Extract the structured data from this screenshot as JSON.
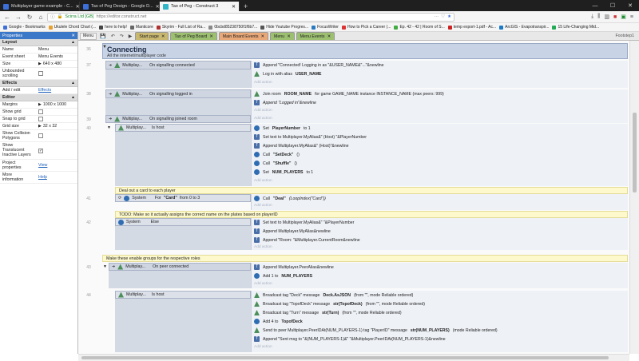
{
  "browser": {
    "tabs": [
      {
        "title": "Multiplayer game example - C...",
        "color": "#3d6fd8"
      },
      {
        "title": "Tao of Peg Design - Google D...",
        "color": "#3d6fd8"
      },
      {
        "title": "Tao of Peg - Construct 3",
        "color": "#2fb6c9"
      }
    ],
    "url_secure_label": "Scirra Ltd [GB]",
    "url": "https://editor.construct.net",
    "bookmarks": [
      "Google - Bookmarks",
      "Ukulele Chord Chart (...",
      "here to help!",
      "Manticore",
      "Skyrim - Full List of Ra...",
      "0bcbd85238750f1f6b7...",
      "Hide Youtube Progres...",
      "FocusWriter",
      "How to Pick a Career (...",
      "Ep. 42 - 42 | Room of S...",
      "temp export-1.pdf - Ac...",
      "ArcGIS - Evapotranspir...",
      "15 Life-Changing Mid..."
    ]
  },
  "properties": {
    "title": "Properties",
    "sections": {
      "layout": "Layout",
      "effects": "Effects",
      "editor": "Editor",
      "more_label_1": "Project properties",
      "more_value_1": "View",
      "more_label_2": "More information",
      "more_value_2": "Help"
    },
    "layout_rows": [
      {
        "k": "Name",
        "v": "Menu"
      },
      {
        "k": "Event sheet",
        "v": "Menu Events"
      },
      {
        "k": "Size",
        "v": "640 x 480"
      },
      {
        "k": "Unbounded scrolling",
        "v": ""
      }
    ],
    "effects_row": {
      "k": "Add / edit",
      "v": "Effects"
    },
    "editor_rows": [
      {
        "k": "Margins",
        "v": "1000 x 1000"
      },
      {
        "k": "Show grid",
        "v": ""
      },
      {
        "k": "Snap to grid",
        "v": ""
      },
      {
        "k": "Grid size",
        "v": "32 x 32"
      },
      {
        "k": "Show Collision Polygons",
        "v": ""
      },
      {
        "k": "Show Translucent Inactive Layers",
        "v": "✓"
      }
    ]
  },
  "editor": {
    "menu_label": "Menu",
    "tabs": [
      {
        "label": "Start page",
        "color": "#c8b870"
      },
      {
        "label": "Tao of Peg Board",
        "color": "#9cc070"
      },
      {
        "label": "Main Board Events",
        "color": "#e8a878"
      },
      {
        "label": "Menu",
        "color": "#9cc070"
      },
      {
        "label": "Menu Events",
        "color": "#9cc070"
      }
    ],
    "footer_tab": "Footstep1"
  },
  "events": {
    "group_title": "Connecting",
    "group_desc": "All the internet/multiplayer code",
    "line_numbers": [
      "36",
      "37",
      "38",
      "39",
      "40",
      "41",
      "42",
      "43",
      "44",
      "45"
    ],
    "e37_object": "Multiplay...",
    "e37_cond": "On signalling connected",
    "e37_a1": "Append \"Connected! Logging in as \"&USER_NAME&\"...\"&newline",
    "e37_a2_pre": "Log in with alias",
    "e37_a2_b": "USER_NAME",
    "e38_object": "Multiplay...",
    "e38_cond": "On signalling logged in",
    "e38_a1_pre": "Join room",
    "e38_a1_b1": "ROOM_NAME",
    "e38_a1_mid": "for game GAME_NAME instance INSTANCE_NAME (max peers: 999)",
    "e38_a2": "Append \"Logged in\"&newline",
    "e39_object": "Multiplay...",
    "e39_cond": "On signalling joined room",
    "e40_object": "Multiplay...",
    "e40_cond": "Is host",
    "e40_a1_pre": "Set",
    "e40_a1_b": "PlayerNumber",
    "e40_a1_post": "to 1",
    "e40_a2": "Set text to Multiplayer.MyAlias&\" (Host) \"&PlayerNumber",
    "e40_a3": "Append Multiplayer.MyAlias&\" (Host)\"&newline",
    "e40_a4_pre": "Call",
    "e40_a4_b": "\"SetDeck\"",
    "e40_a4_post": "()",
    "e40_a5_pre": "Call",
    "e40_a5_b": "\"Shuffle\"",
    "e40_a5_post": "()",
    "e40_a6_pre": "Set",
    "e40_a6_b": "NUM_PLAYERS",
    "e40_a6_post": "to 1",
    "comment1": "Deal out a card to each player",
    "e41_object": "System",
    "e41_cond_pre": "For",
    "e41_cond_b": "\"Card\"",
    "e41_cond_post": "from 0 to 3",
    "e41_a1_pre": "Call",
    "e41_a1_b": "\"Deal\"",
    "e41_a1_post": "(LoopIndex(\"Card\"))",
    "comment2": "TODO: Make so it actually assigns the correct name on the plates based on playerID",
    "e42_object": "System",
    "e42_cond": "Else",
    "e42_a1": "Set text to Multiplayer.MyAlias&\" \"&PlayerNumber",
    "e42_a2": "Append Multiplayer.MyAlias&newline",
    "e42_a3": "Append \"Room: \"&Multiplayer.CurrentRoom&newline",
    "comment3": "Make these enable groups for the respective roles",
    "e43_object": "Multiplay...",
    "e43_cond": "On peer connected",
    "e43_a1": "Append Multiplayer.PeerAlias&newline",
    "e43_a2_pre": "Add 1 to",
    "e43_a2_b": "NUM_PLAYERS",
    "e44_object": "Multiplay...",
    "e44_cond": "Is host",
    "e44_a1_pre": "Broadcast tag \"Deck\" message",
    "e44_a1_b": "Deck.AsJSON",
    "e44_a1_post": "(from \"\", mode Reliable ordered)",
    "e44_a2_pre": "Broadcast tag \"TopofDeck\" message",
    "e44_a2_b": "str(TopofDeck)",
    "e44_a2_post": "(from \"\", mode Reliable ordered)",
    "e44_a3_pre": "Broadcast tag \"Turn\" message",
    "e44_a3_b": "str(Turn)",
    "e44_a3_post": "(from \"\", mode Reliable ordered)",
    "e44_a4_pre": "Add 4 to",
    "e44_a4_b": "TopofDeck",
    "e44_a5_pre": "Send to peer Multiplayer.PeerIDAt(NUM_PLAYERS-1) tag \"PlayerID\" message",
    "e44_a5_b": "str(NUM_PLAYERS)",
    "e44_a5_post": "(mode Reliable ordered)",
    "e44_a6": "Append \"Sent msg to \"&(NUM_PLAYERS-1)&\" \"&Multiplayer.PeerIDAt(NUM_PLAYERS-1)&newline",
    "add_action": "Add action",
    "system_prefix": "System"
  }
}
